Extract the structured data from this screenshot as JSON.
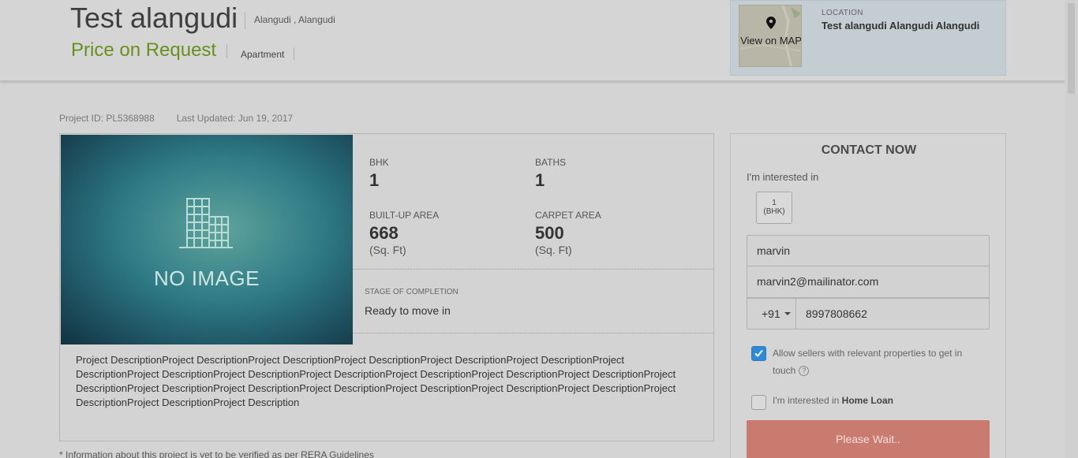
{
  "header": {
    "title": "Test alangudi",
    "locality": "Alangudi , Alangudi",
    "price": "Price on Request",
    "property_type": "Apartment",
    "map": {
      "label": "View on MAP",
      "location_label": "LOCATION",
      "location_value": "Test alangudi Alangudi Alangudi"
    }
  },
  "meta": {
    "project_id": "Project ID: PL5368988",
    "last_updated": "Last Updated: Jun 19, 2017"
  },
  "listing": {
    "image_placeholder": "NO IMAGE",
    "specs": {
      "bhk_label": "BHK",
      "bhk_value": "1",
      "baths_label": "BATHS",
      "baths_value": "1",
      "builtup_label": "BUILT-UP AREA",
      "builtup_value": "668",
      "builtup_unit": "(Sq. Ft)",
      "carpet_label": "CARPET AREA",
      "carpet_value": "500",
      "carpet_unit": "(Sq. Ft)"
    },
    "stage_label": "STAGE OF COMPLETION",
    "stage_value": "Ready to move in",
    "description": "Project DescriptionProject DescriptionProject DescriptionProject DescriptionProject DescriptionProject DescriptionProject DescriptionProject DescriptionProject DescriptionProject DescriptionProject DescriptionProject DescriptionProject DescriptionProject DescriptionProject DescriptionProject DescriptionProject DescriptionProject DescriptionProject DescriptionProject DescriptionProject DescriptionProject DescriptionProject Description"
  },
  "rera_note": "* Information about this project is yet to be verified as per RERA Guidelines",
  "contact": {
    "title": "CONTACT NOW",
    "interest_label": "I'm interested in",
    "bhk_chip_value": "1",
    "bhk_chip_unit": "(BHK)",
    "name_value": "marvin",
    "email_value": "marvin2@mailinator.com",
    "country_code": "+91",
    "phone_value": "8997808662",
    "consent_text": "Allow sellers with relevant properties to get in touch",
    "consent_checked": true,
    "home_loan_prefix": "I'm interested in",
    "home_loan_bold": "Home Loan",
    "home_loan_checked": false,
    "submit_label": "Please Wait.."
  },
  "colors": {
    "price": "#6b8f1f",
    "checkbox_accent": "#2f8ad6",
    "submit_button": "#c97b70"
  },
  "icons": [
    "map-pin-icon",
    "building-icon",
    "chevron-down-icon",
    "checkmark-icon",
    "help-icon"
  ]
}
